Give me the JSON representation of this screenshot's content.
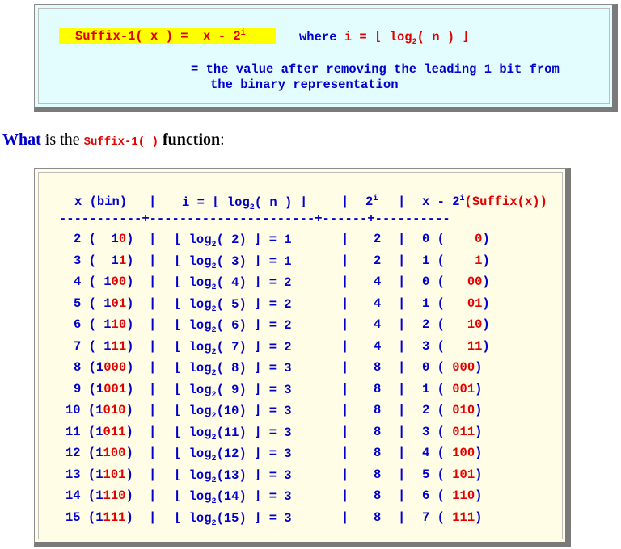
{
  "definition": {
    "fn_name": "Suffix-1( x )",
    "equals": "=",
    "rhs_base": "x - 2",
    "rhs_exp": "i",
    "where_label": "where",
    "i_def_prefix": "i = ⌊ log",
    "log_base": "2",
    "i_def_suffix": "( n ) ⌋",
    "line2": "= the value after removing the leading 1 bit from",
    "line3": "the binary representation"
  },
  "heading": {
    "what": "What",
    "is_the": " is the ",
    "fn": "Suffix-1( )",
    "function": " function",
    "colon": ":"
  },
  "table": {
    "headers": {
      "col1": "x (bin)",
      "col2_prefix": "i = ⌊ log",
      "col2_base": "2",
      "col2_suffix": "( n ) ⌋",
      "col3_base": "2",
      "col3_exp": "i",
      "col4_prefix": "x - 2",
      "col4_exp": "i",
      "col4_suffix": "(Suffix(x))"
    },
    "rows": [
      {
        "n": "2",
        "bin_lead": "1",
        "bin_rest": "0",
        "pad": "  ",
        "i": "1",
        "p": "2",
        "q": "0",
        "suf": "0",
        "suf_pad": "    "
      },
      {
        "n": "3",
        "bin_lead": "1",
        "bin_rest": "1",
        "pad": "  ",
        "i": "1",
        "p": "2",
        "q": "1",
        "suf": "1",
        "suf_pad": "    "
      },
      {
        "n": "4",
        "bin_lead": "1",
        "bin_rest": "00",
        "pad": " ",
        "i": "2",
        "p": "4",
        "q": "0",
        "suf": "00",
        "suf_pad": "   "
      },
      {
        "n": "5",
        "bin_lead": "1",
        "bin_rest": "01",
        "pad": " ",
        "i": "2",
        "p": "4",
        "q": "1",
        "suf": "01",
        "suf_pad": "   "
      },
      {
        "n": "6",
        "bin_lead": "1",
        "bin_rest": "10",
        "pad": " ",
        "i": "2",
        "p": "4",
        "q": "2",
        "suf": "10",
        "suf_pad": "   "
      },
      {
        "n": "7",
        "bin_lead": "1",
        "bin_rest": "11",
        "pad": " ",
        "i": "2",
        "p": "4",
        "q": "3",
        "suf": "11",
        "suf_pad": "   "
      },
      {
        "n": "8",
        "bin_lead": "1",
        "bin_rest": "000",
        "pad": "",
        "i": "3",
        "p": "8",
        "q": "0",
        "suf": "000",
        "suf_pad": " "
      },
      {
        "n": "9",
        "bin_lead": "1",
        "bin_rest": "001",
        "pad": "",
        "i": "3",
        "p": "8",
        "q": "1",
        "suf": "001",
        "suf_pad": " "
      },
      {
        "n": "10",
        "bin_lead": "1",
        "bin_rest": "010",
        "pad": "",
        "i": "3",
        "p": "8",
        "q": "2",
        "suf": "010",
        "suf_pad": " "
      },
      {
        "n": "11",
        "bin_lead": "1",
        "bin_rest": "011",
        "pad": "",
        "i": "3",
        "p": "8",
        "q": "3",
        "suf": "011",
        "suf_pad": " "
      },
      {
        "n": "12",
        "bin_lead": "1",
        "bin_rest": "100",
        "pad": "",
        "i": "3",
        "p": "8",
        "q": "4",
        "suf": "100",
        "suf_pad": " "
      },
      {
        "n": "13",
        "bin_lead": "1",
        "bin_rest": "101",
        "pad": "",
        "i": "3",
        "p": "8",
        "q": "5",
        "suf": "101",
        "suf_pad": " "
      },
      {
        "n": "14",
        "bin_lead": "1",
        "bin_rest": "110",
        "pad": "",
        "i": "3",
        "p": "8",
        "q": "6",
        "suf": "110",
        "suf_pad": " "
      },
      {
        "n": "15",
        "bin_lead": "1",
        "bin_rest": "111",
        "pad": "",
        "i": "3",
        "p": "8",
        "q": "7",
        "suf": "111",
        "suf_pad": " "
      }
    ]
  },
  "colors": {
    "blue": "#0000cc",
    "red": "#e00000",
    "highlight": "#ffff00",
    "def_bg": "#e3fdfe",
    "table_bg": "#fffde6"
  }
}
